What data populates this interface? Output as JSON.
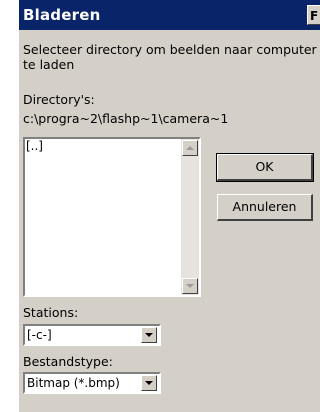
{
  "window": {
    "title": "Bladeren",
    "close_glyph": "F"
  },
  "instruction": {
    "line1": "Selecteer directory om beelden naar computer",
    "line2": "te laden"
  },
  "directories": {
    "label": "Directory's:",
    "path": "c:\\progra~2\\flashp~1\\camera~1",
    "items": [
      "[..]"
    ]
  },
  "buttons": {
    "ok": "OK",
    "cancel": "Annuleren"
  },
  "drives": {
    "label": "Stations:",
    "value": "[-c-]"
  },
  "filetype": {
    "label": "Bestandstype:",
    "value": "Bitmap (*.bmp)"
  },
  "icons": {
    "scroll_up": "scroll-up-arrow-icon",
    "scroll_down": "scroll-down-arrow-icon",
    "dropdown": "chevron-down-icon"
  }
}
